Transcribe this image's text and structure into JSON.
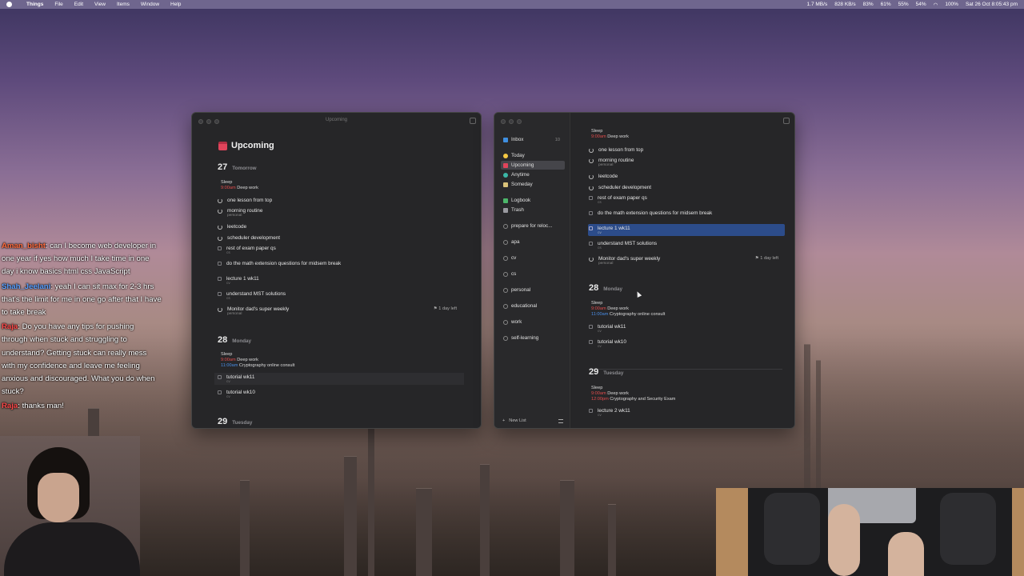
{
  "menubar": {
    "app": "Things",
    "menus": [
      "File",
      "Edit",
      "View",
      "Items",
      "Window",
      "Help"
    ],
    "status": [
      "1.7 MB/s",
      "828 KB/s",
      "83%",
      "61%",
      "55%",
      "54%",
      "100%"
    ],
    "clock": "Sat 26 Oct 8:05:43 pm"
  },
  "chat": [
    {
      "user": "Aman_bisht",
      "text": ": can I become web developer in one year if yes how much I take time in one day i know basics html css JavaScript"
    },
    {
      "user": "Shah_Jeelani",
      "text": ": yeah I can sit max for 2-3 hrs that's the limit for me in one go after that I have to take break"
    },
    {
      "user": "Raja",
      "text": ": Do you have any tips for pushing through when stuck and struggling to understand? Getting stuck can really mess with my confidence and leave me feeling anxious and discouraged. What you do when stuck?"
    },
    {
      "user": "Raja",
      "text": ": thanks man!"
    }
  ],
  "left_window": {
    "title": "Upcoming",
    "heading": "Upcoming",
    "day27": {
      "num": "27",
      "name": "Tomorrow"
    },
    "ev27": {
      "sleep": "Sleep",
      "time1": "9:00am",
      "deep": "Deep work"
    },
    "tasks27": [
      {
        "label": "one lesson from top",
        "sub": ""
      },
      {
        "label": "morning routine",
        "sub": "personal"
      },
      {
        "label": "leetcode",
        "sub": ""
      },
      {
        "label": "scheduler development",
        "sub": ""
      },
      {
        "label": "rest of exam paper qs",
        "sub": "cs"
      },
      {
        "label": "do the math extension questions for midsem break",
        "sub": ""
      },
      {
        "label": "lecture 1 wk11",
        "sub": "cv"
      },
      {
        "label": "understand MST solutions",
        "sub": "cs"
      },
      {
        "label": "Monitor dad's super weekly",
        "sub": "personal"
      }
    ],
    "deadline": "1 day left",
    "day28": {
      "num": "28",
      "name": "Monday"
    },
    "ev28": {
      "sleep": "Sleep",
      "time1": "9:00am",
      "deep": "Deep work",
      "time2": "11:00am",
      "consult": "Cryptography online consult"
    },
    "tasks28": [
      {
        "label": "tutorial wk11",
        "sub": "cv"
      },
      {
        "label": "tutorial wk10",
        "sub": "cv"
      }
    ],
    "day29": {
      "num": "29",
      "name": "Tuesday"
    }
  },
  "right_window": {
    "sidebar": {
      "inbox": "Inbox",
      "inbox_count": "10",
      "today": "Today",
      "upcoming": "Upcoming",
      "anytime": "Anytime",
      "someday": "Someday",
      "logbook": "Logbook",
      "trash": "Trash",
      "projects": [
        "prepare for reloc...",
        "apa",
        "cv",
        "cs",
        "personal",
        "educational",
        "work",
        "self-learning"
      ],
      "new_list": "New List"
    },
    "ev_top": {
      "sleep": "Sleep",
      "time1": "9:00am",
      "deep": "Deep work"
    },
    "tasks27": [
      {
        "label": "one lesson from top",
        "sub": ""
      },
      {
        "label": "morning routine",
        "sub": "personal"
      },
      {
        "label": "leetcode",
        "sub": ""
      },
      {
        "label": "scheduler development",
        "sub": ""
      },
      {
        "label": "rest of exam paper qs",
        "sub": "cs"
      },
      {
        "label": "do the math extension questions for midsem break",
        "sub": ""
      },
      {
        "label": "lecture 1 wk11",
        "sub": "cv"
      },
      {
        "label": "understand MST solutions",
        "sub": "cs"
      },
      {
        "label": "Monitor dad's super weekly",
        "sub": "personal"
      }
    ],
    "deadline": "1 day left",
    "day28": {
      "num": "28",
      "name": "Monday"
    },
    "ev28": {
      "sleep": "Sleep",
      "time1": "9:00am",
      "deep": "Deep work",
      "time2": "11:00am",
      "consult": "Cryptography online consult"
    },
    "tasks28": [
      {
        "label": "tutorial wk11",
        "sub": "cv"
      },
      {
        "label": "tutorial wk10",
        "sub": "cv"
      }
    ],
    "day29": {
      "num": "29",
      "name": "Tuesday"
    },
    "ev29": {
      "sleep": "Sleep",
      "time1": "9:00am",
      "deep": "Deep work",
      "time2": "12:00pm",
      "exam": "Cryptography and Security Exam"
    },
    "tasks29": [
      {
        "label": "lecture 2 wk11",
        "sub": "cv"
      }
    ]
  },
  "colors": {
    "accent_red": "#e0445b",
    "selection_blue": "#2c4c8a",
    "event_blue": "#4a8ee6"
  }
}
